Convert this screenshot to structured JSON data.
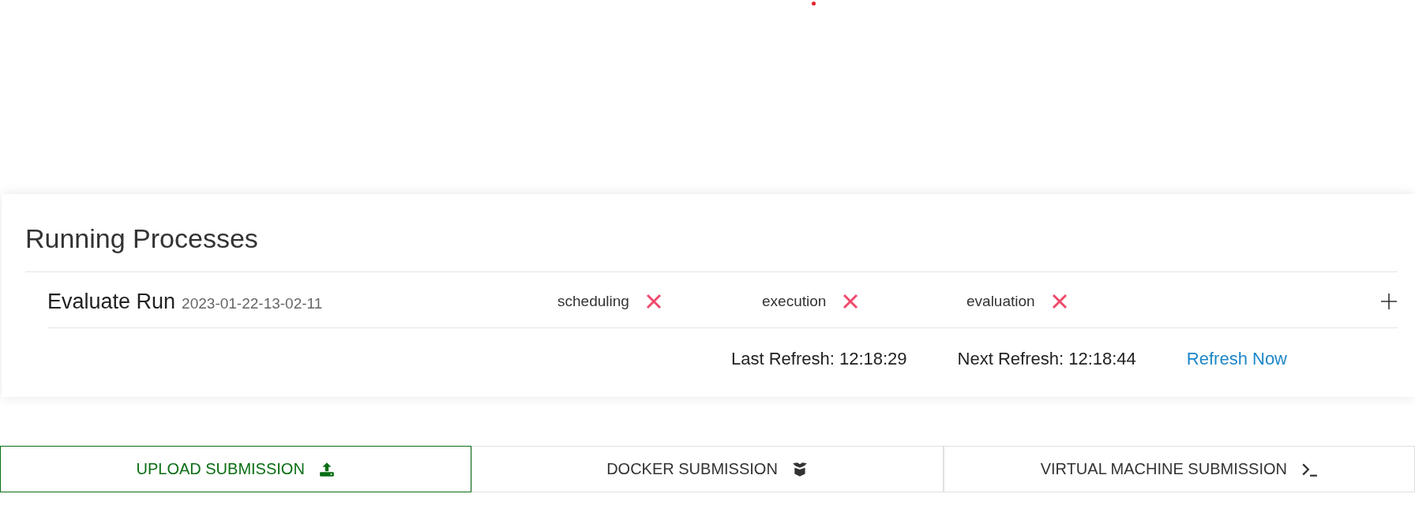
{
  "panel": {
    "title": "Running Processes",
    "processes": [
      {
        "name": "Evaluate Run",
        "timestamp": "2023-01-22-13-02-11",
        "expanded": false,
        "stages": [
          {
            "label": "scheduling",
            "failed": true
          },
          {
            "label": "execution",
            "failed": true
          },
          {
            "label": "evaluation",
            "failed": true
          }
        ]
      }
    ],
    "last_refresh": "Last Refresh: 12:18:29",
    "next_refresh": "Next Refresh: 12:18:44",
    "refresh_link": "Refresh Now"
  },
  "submission_tabs": [
    {
      "label": "UPLOAD SUBMISSION",
      "kind": "upload",
      "selected": true
    },
    {
      "label": "DOCKER SUBMISSION",
      "kind": "docker",
      "selected": false
    },
    {
      "label": "VIRTUAL MACHINE SUBMISSION",
      "kind": "vm",
      "selected": false
    }
  ]
}
